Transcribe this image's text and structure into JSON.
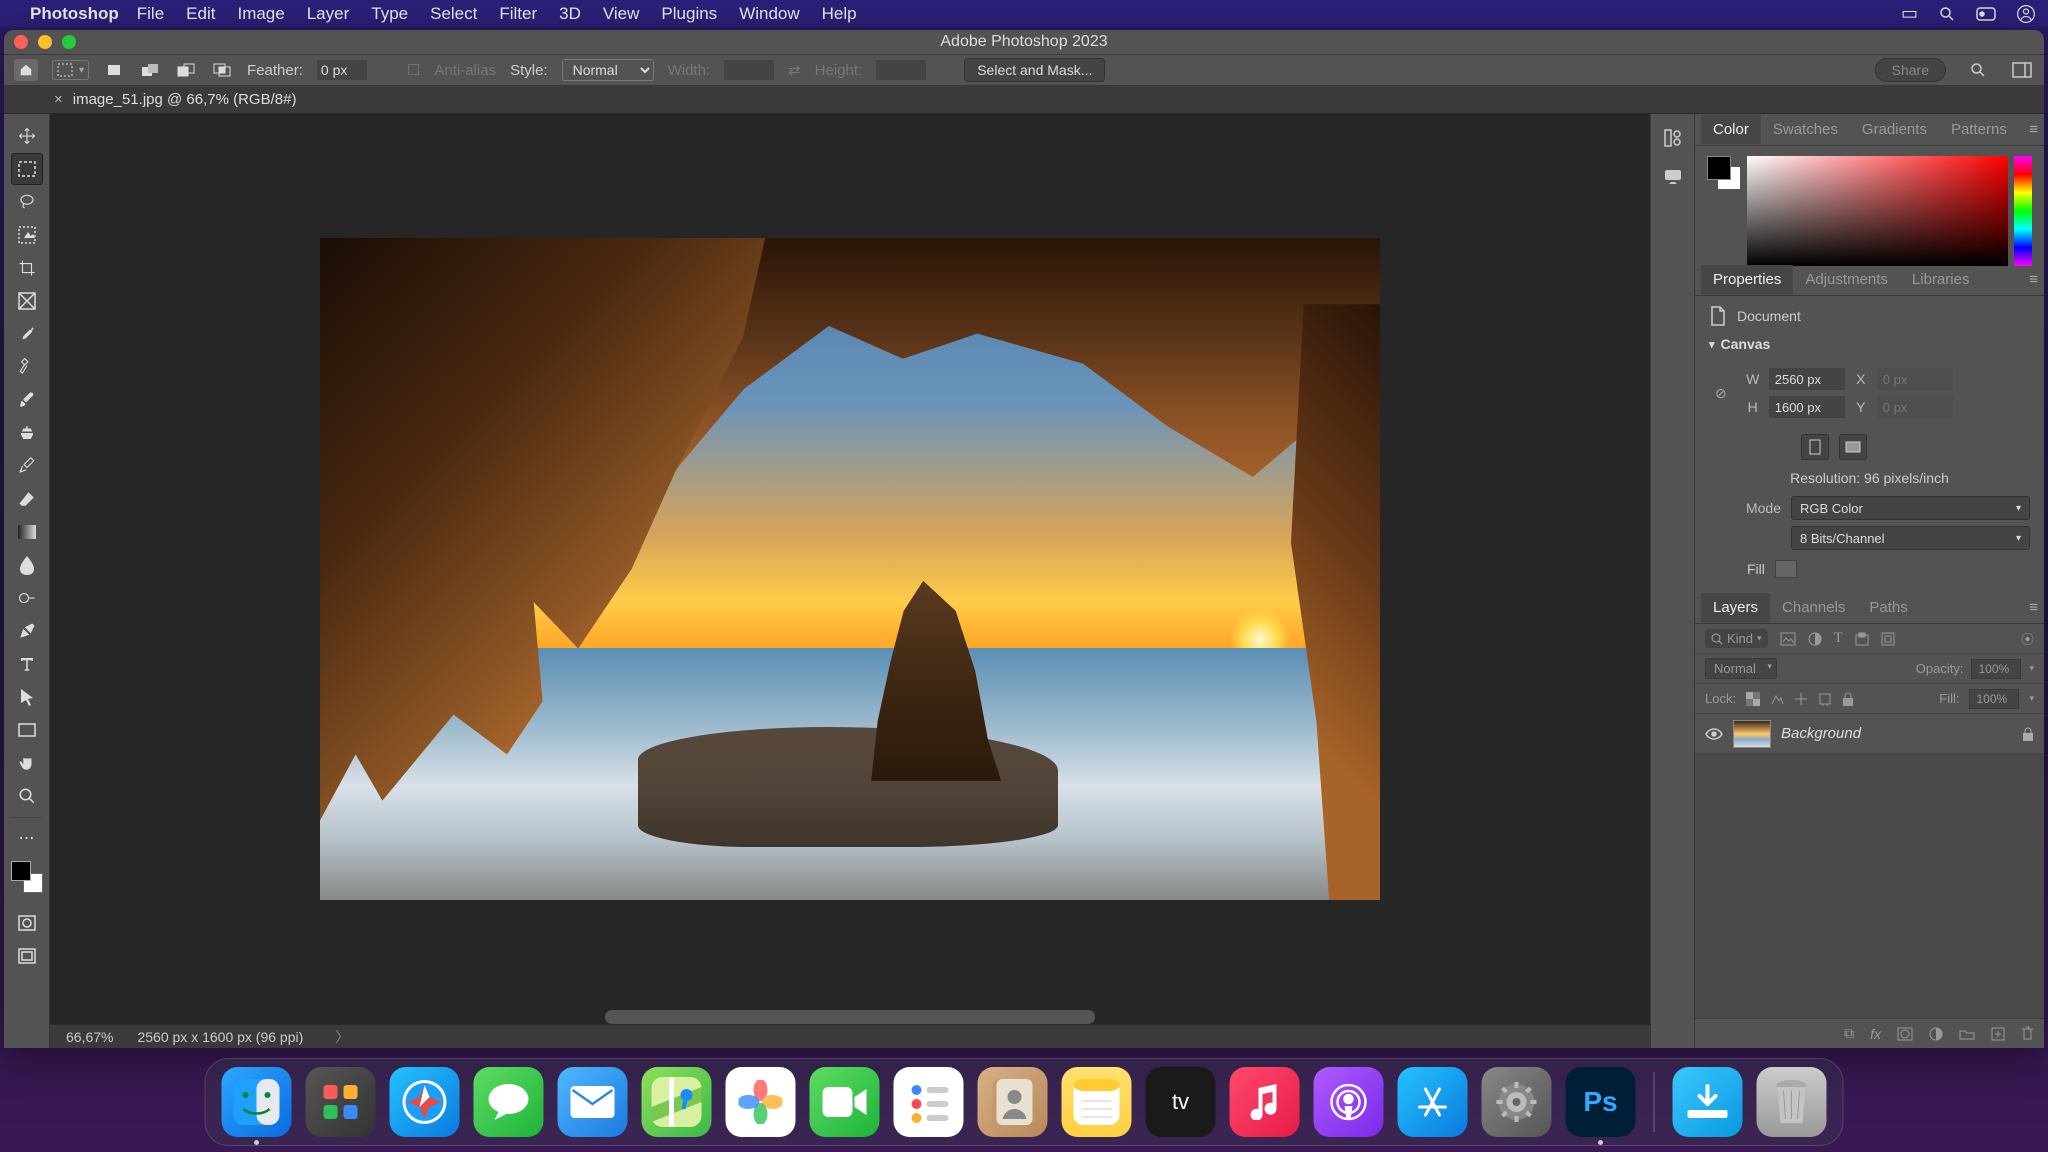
{
  "mac_menu": {
    "app": "Photoshop",
    "items": [
      "File",
      "Edit",
      "Image",
      "Layer",
      "Type",
      "Select",
      "Filter",
      "3D",
      "View",
      "Plugins",
      "Window",
      "Help"
    ]
  },
  "window_title": "Adobe Photoshop 2023",
  "options_bar": {
    "feather_label": "Feather:",
    "feather_value": "0 px",
    "antialias": "Anti-alias",
    "style_label": "Style:",
    "style_value": "Normal",
    "width_label": "Width:",
    "width_value": "",
    "height_label": "Height:",
    "height_value": "",
    "select_mask": "Select and Mask...",
    "share": "Share"
  },
  "doc_tab": {
    "title": "image_51.jpg @ 66,7% (RGB/8#)"
  },
  "status": {
    "zoom": "66,67%",
    "dims": "2560 px x 1600 px (96 ppi)"
  },
  "panel_color": {
    "tabs": [
      "Color",
      "Swatches",
      "Gradients",
      "Patterns"
    ]
  },
  "panel_props": {
    "tabs": [
      "Properties",
      "Adjustments",
      "Libraries"
    ],
    "doc_label": "Document",
    "canvas_label": "Canvas",
    "W": "W",
    "W_val": "2560 px",
    "H": "H",
    "H_val": "1600 px",
    "X": "X",
    "X_ph": "0 px",
    "Y": "Y",
    "Y_ph": "0 px",
    "resolution": "Resolution: 96 pixels/inch",
    "mode_label": "Mode",
    "mode_value": "RGB Color",
    "depth_value": "8 Bits/Channel",
    "fill_label": "Fill"
  },
  "panel_layers": {
    "tabs": [
      "Layers",
      "Channels",
      "Paths"
    ],
    "kind": "Kind",
    "blend": "Normal",
    "opacity_label": "Opacity:",
    "opacity_value": "100%",
    "lock_label": "Lock:",
    "fill_label": "Fill:",
    "fill_value": "100%",
    "layer_name": "Background"
  },
  "dock": {
    "items": [
      "Finder",
      "Launchpad",
      "Safari",
      "Messages",
      "Mail",
      "Maps",
      "Photos",
      "FaceTime",
      "Reminders",
      "Contacts",
      "Notes",
      "TV",
      "Music",
      "Podcasts",
      "App Store",
      "System Settings",
      "Photoshop"
    ],
    "right_items": [
      "Downloads",
      "Trash"
    ]
  }
}
